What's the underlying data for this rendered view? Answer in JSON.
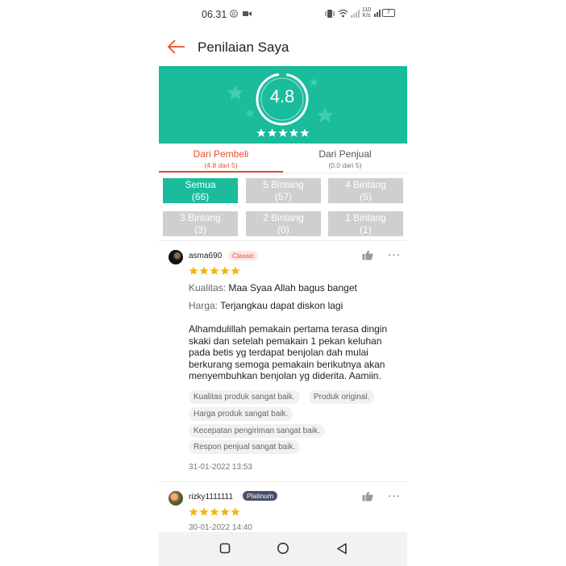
{
  "status_bar": {
    "time": "06.31",
    "network_speed_value": "110",
    "network_speed_unit": "K/s",
    "battery": "7",
    "icons": [
      "notification-b-icon",
      "video-record-icon",
      "vibrate-icon",
      "wifi-icon",
      "signal-icon",
      "battery-icon"
    ]
  },
  "header": {
    "title": "Penilaian Saya",
    "back_icon": "arrow-left-icon"
  },
  "rating": {
    "score": "4.8",
    "stars": 5
  },
  "tabs": [
    {
      "label": "Dari Pembeli",
      "sub": "(4.8 dari 5)",
      "active": true
    },
    {
      "label": "Dari Penjual",
      "sub": "(0.0 dari 5)",
      "active": false
    }
  ],
  "filters": [
    {
      "label": "Semua",
      "count": "(66)",
      "active": true
    },
    {
      "label": "5 Bintang",
      "count": "(57)",
      "active": false
    },
    {
      "label": "4 Bintang",
      "count": "(5)",
      "active": false
    },
    {
      "label": "3 Bintang",
      "count": "(3)",
      "active": false
    },
    {
      "label": "2 Bintang",
      "count": "(0)",
      "active": false
    },
    {
      "label": "1 Bintang",
      "count": "(1)",
      "active": false
    }
  ],
  "reviews": [
    {
      "username": "asma690",
      "badge": "Classic",
      "stars": 5,
      "quality_label": "Kualitas:",
      "quality_value": "Maa Syaa Allah bagus banget",
      "price_label": "Harga:",
      "price_value": "Terjangkau dapat diskon lagi",
      "body": "Alhamdulillah pemakain pertama terasa dingin skaki dan setelah pemakain 1 pekan keluhan pada betis yg terdapat benjolan dah mulai berkurang semoga pemakain berikutnya akan menyembuhkan benjolan yg diderita. Aamiin.",
      "tags": [
        "Kualitas produk sangat baik.",
        "Produk original.",
        "Harga produk sangat baik.",
        "Kecepatan pengiriman sangat baik.",
        "Respon penjual sangat baik."
      ],
      "date": "31-01-2022 13:53",
      "more": "···"
    },
    {
      "username": "rizky1111111",
      "badge": "Platinum",
      "stars": 5,
      "date": "30-01-2022 14:40",
      "more": "···"
    }
  ],
  "colors": {
    "accent": "#ee4d2d",
    "banner": "#1abc9c",
    "star": "#f5b400",
    "inactive_filter": "#cfcfcf"
  }
}
